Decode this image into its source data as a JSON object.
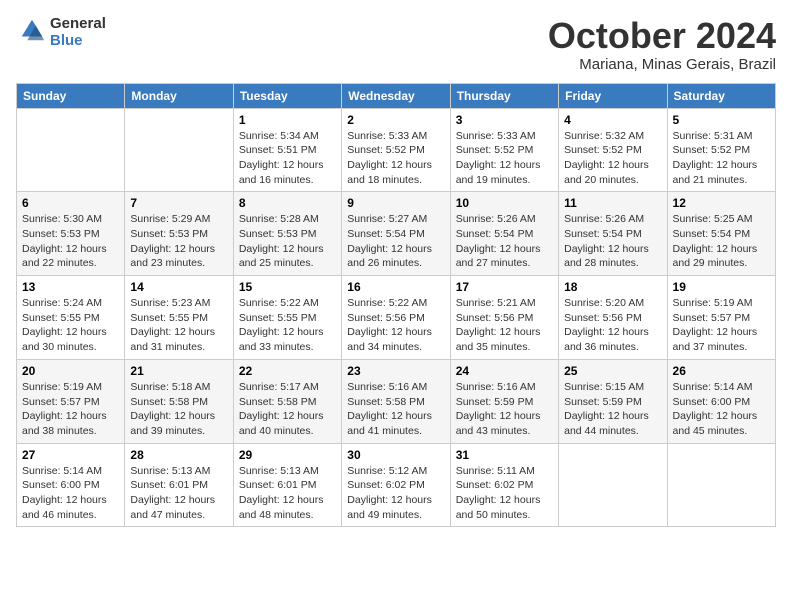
{
  "header": {
    "logo_general": "General",
    "logo_blue": "Blue",
    "month_title": "October 2024",
    "location": "Mariana, Minas Gerais, Brazil"
  },
  "days_of_week": [
    "Sunday",
    "Monday",
    "Tuesday",
    "Wednesday",
    "Thursday",
    "Friday",
    "Saturday"
  ],
  "weeks": [
    [
      null,
      null,
      {
        "day": 1,
        "sunrise": "5:34 AM",
        "sunset": "5:51 PM",
        "daylight": "12 hours and 16 minutes."
      },
      {
        "day": 2,
        "sunrise": "5:33 AM",
        "sunset": "5:52 PM",
        "daylight": "12 hours and 18 minutes."
      },
      {
        "day": 3,
        "sunrise": "5:33 AM",
        "sunset": "5:52 PM",
        "daylight": "12 hours and 19 minutes."
      },
      {
        "day": 4,
        "sunrise": "5:32 AM",
        "sunset": "5:52 PM",
        "daylight": "12 hours and 20 minutes."
      },
      {
        "day": 5,
        "sunrise": "5:31 AM",
        "sunset": "5:52 PM",
        "daylight": "12 hours and 21 minutes."
      }
    ],
    [
      {
        "day": 6,
        "sunrise": "5:30 AM",
        "sunset": "5:53 PM",
        "daylight": "12 hours and 22 minutes."
      },
      {
        "day": 7,
        "sunrise": "5:29 AM",
        "sunset": "5:53 PM",
        "daylight": "12 hours and 23 minutes."
      },
      {
        "day": 8,
        "sunrise": "5:28 AM",
        "sunset": "5:53 PM",
        "daylight": "12 hours and 25 minutes."
      },
      {
        "day": 9,
        "sunrise": "5:27 AM",
        "sunset": "5:54 PM",
        "daylight": "12 hours and 26 minutes."
      },
      {
        "day": 10,
        "sunrise": "5:26 AM",
        "sunset": "5:54 PM",
        "daylight": "12 hours and 27 minutes."
      },
      {
        "day": 11,
        "sunrise": "5:26 AM",
        "sunset": "5:54 PM",
        "daylight": "12 hours and 28 minutes."
      },
      {
        "day": 12,
        "sunrise": "5:25 AM",
        "sunset": "5:54 PM",
        "daylight": "12 hours and 29 minutes."
      }
    ],
    [
      {
        "day": 13,
        "sunrise": "5:24 AM",
        "sunset": "5:55 PM",
        "daylight": "12 hours and 30 minutes."
      },
      {
        "day": 14,
        "sunrise": "5:23 AM",
        "sunset": "5:55 PM",
        "daylight": "12 hours and 31 minutes."
      },
      {
        "day": 15,
        "sunrise": "5:22 AM",
        "sunset": "5:55 PM",
        "daylight": "12 hours and 33 minutes."
      },
      {
        "day": 16,
        "sunrise": "5:22 AM",
        "sunset": "5:56 PM",
        "daylight": "12 hours and 34 minutes."
      },
      {
        "day": 17,
        "sunrise": "5:21 AM",
        "sunset": "5:56 PM",
        "daylight": "12 hours and 35 minutes."
      },
      {
        "day": 18,
        "sunrise": "5:20 AM",
        "sunset": "5:56 PM",
        "daylight": "12 hours and 36 minutes."
      },
      {
        "day": 19,
        "sunrise": "5:19 AM",
        "sunset": "5:57 PM",
        "daylight": "12 hours and 37 minutes."
      }
    ],
    [
      {
        "day": 20,
        "sunrise": "5:19 AM",
        "sunset": "5:57 PM",
        "daylight": "12 hours and 38 minutes."
      },
      {
        "day": 21,
        "sunrise": "5:18 AM",
        "sunset": "5:58 PM",
        "daylight": "12 hours and 39 minutes."
      },
      {
        "day": 22,
        "sunrise": "5:17 AM",
        "sunset": "5:58 PM",
        "daylight": "12 hours and 40 minutes."
      },
      {
        "day": 23,
        "sunrise": "5:16 AM",
        "sunset": "5:58 PM",
        "daylight": "12 hours and 41 minutes."
      },
      {
        "day": 24,
        "sunrise": "5:16 AM",
        "sunset": "5:59 PM",
        "daylight": "12 hours and 43 minutes."
      },
      {
        "day": 25,
        "sunrise": "5:15 AM",
        "sunset": "5:59 PM",
        "daylight": "12 hours and 44 minutes."
      },
      {
        "day": 26,
        "sunrise": "5:14 AM",
        "sunset": "6:00 PM",
        "daylight": "12 hours and 45 minutes."
      }
    ],
    [
      {
        "day": 27,
        "sunrise": "5:14 AM",
        "sunset": "6:00 PM",
        "daylight": "12 hours and 46 minutes."
      },
      {
        "day": 28,
        "sunrise": "5:13 AM",
        "sunset": "6:01 PM",
        "daylight": "12 hours and 47 minutes."
      },
      {
        "day": 29,
        "sunrise": "5:13 AM",
        "sunset": "6:01 PM",
        "daylight": "12 hours and 48 minutes."
      },
      {
        "day": 30,
        "sunrise": "5:12 AM",
        "sunset": "6:02 PM",
        "daylight": "12 hours and 49 minutes."
      },
      {
        "day": 31,
        "sunrise": "5:11 AM",
        "sunset": "6:02 PM",
        "daylight": "12 hours and 50 minutes."
      },
      null,
      null
    ]
  ]
}
